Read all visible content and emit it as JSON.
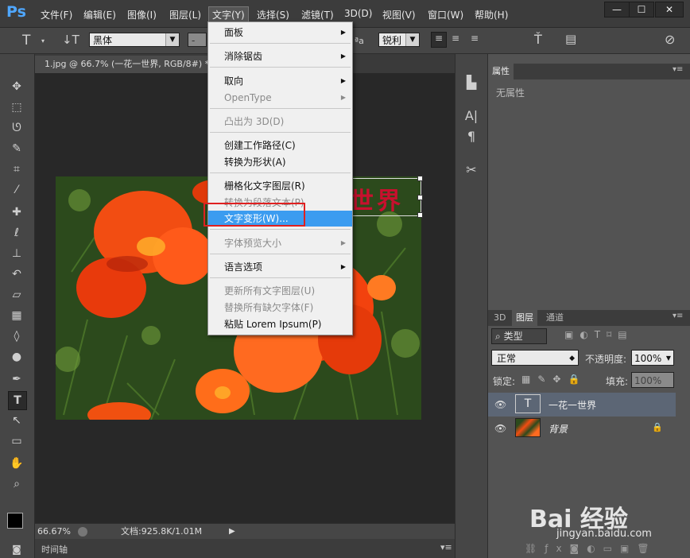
{
  "app": {
    "logo": "Ps",
    "menu": [
      "文件(F)",
      "编辑(E)",
      "图像(I)",
      "图层(L)",
      "文字(Y)",
      "选择(S)",
      "滤镜(T)",
      "3D(D)",
      "视图(V)",
      "窗口(W)",
      "帮助(H)"
    ],
    "window_buttons": [
      "—",
      "☐",
      "✕"
    ]
  },
  "options_bar": {
    "font_family": "黑体",
    "font_size": "-",
    "anti_alias_label": "ªa",
    "anti_alias": "锐利",
    "color": "#d0021b"
  },
  "document": {
    "tab_title": "1.jpg @ 66.7% (一花一世界, RGB/8#) *",
    "canvas_text": "世界",
    "canvas_text_color": "#c8102e",
    "zoom": "66.67%",
    "doc_info": "文档:925.8K/1.01M",
    "timeline_label": "时间轴"
  },
  "text_menu": {
    "items": [
      {
        "label": "面板",
        "sub": true,
        "disabled": false
      },
      {
        "label": "消除锯齿",
        "sub": true,
        "disabled": false
      },
      {
        "label": "取向",
        "sub": true,
        "disabled": false
      },
      {
        "label": "OpenType",
        "sub": true,
        "disabled": true
      },
      {
        "label": "凸出为 3D(D)",
        "sub": false,
        "disabled": true
      },
      {
        "label": "创建工作路径(C)",
        "sub": false,
        "disabled": false
      },
      {
        "label": "转换为形状(A)",
        "sub": false,
        "disabled": false
      },
      {
        "label": "栅格化文字图层(R)",
        "sub": false,
        "disabled": false
      },
      {
        "label": "转换为段落文本(P)",
        "sub": false,
        "disabled": true
      },
      {
        "label": "文字变形(W)...",
        "sub": false,
        "disabled": false,
        "highlighted": true
      },
      {
        "label": "字体预览大小",
        "sub": true,
        "disabled": true
      },
      {
        "label": "语言选项",
        "sub": true,
        "disabled": false
      },
      {
        "label": "更新所有文字图层(U)",
        "sub": false,
        "disabled": true
      },
      {
        "label": "替换所有缺欠字体(F)",
        "sub": false,
        "disabled": true
      },
      {
        "label": "粘贴 Lorem Ipsum(P)",
        "sub": false,
        "disabled": false
      }
    ]
  },
  "properties_panel": {
    "tab": "属性",
    "empty_text": "无属性"
  },
  "layers_panel": {
    "tabs": [
      "3D",
      "图层",
      "通道"
    ],
    "filter_kind": "类型",
    "blend_mode": "正常",
    "opacity_label": "不透明度:",
    "opacity": "100%",
    "lock_label": "锁定:",
    "fill_label": "填充:",
    "fill": "100%",
    "layers": [
      {
        "name": "一花一世界",
        "type": "text",
        "selected": true
      },
      {
        "name": "背景",
        "type": "image",
        "locked": true
      }
    ]
  },
  "watermark": {
    "brand": "Bai 经验",
    "url": "jingyan.baidu.com"
  }
}
